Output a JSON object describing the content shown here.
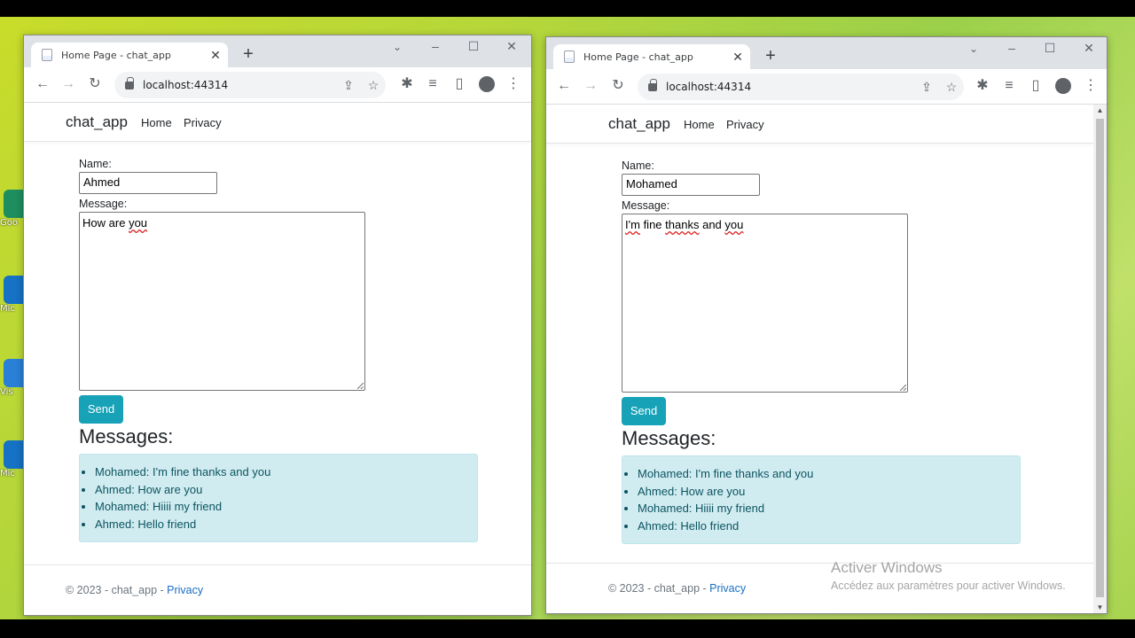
{
  "browser": {
    "tab_title": "Home Page - chat_app",
    "url": "localhost:44314"
  },
  "app": {
    "brand": "chat_app",
    "nav": [
      "Home",
      "Privacy"
    ]
  },
  "form": {
    "name_label": "Name:",
    "message_label": "Message:",
    "send_label": "Send"
  },
  "left": {
    "name_value": "Ahmed",
    "message_words": [
      "How",
      "are",
      "you"
    ]
  },
  "right": {
    "name_value": "Mohamed",
    "message_words": [
      "I'm",
      "fine",
      "thanks",
      "and",
      "you"
    ]
  },
  "messages": {
    "heading": "Messages:",
    "items": [
      "Mohamed: I'm fine thanks and you",
      "Ahmed: How are you",
      "Mohamed: Hiiii my friend",
      "Ahmed: Hello friend"
    ]
  },
  "footer": {
    "text": "© 2023 - chat_app - ",
    "link": "Privacy"
  },
  "watermark": {
    "line1": "Activer Windows",
    "line2": "Accédez aux paramètres pour activer Windows."
  },
  "colors": {
    "send_button": "#17a2b8",
    "alert_bg": "#d1ecf1",
    "alert_text": "#0c5460",
    "link": "#1b6ec2"
  }
}
